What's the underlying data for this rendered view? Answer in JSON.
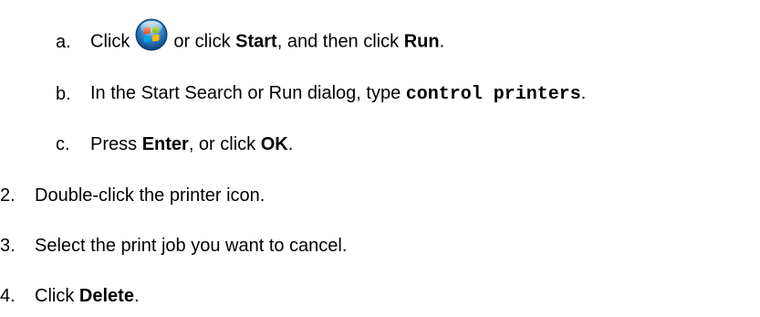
{
  "steps": {
    "a": {
      "marker": "a.",
      "text_before": "Click",
      "text_or": "or click",
      "start": "Start",
      "text_then": ", and then click",
      "run": "Run",
      "end": "."
    },
    "b": {
      "marker": "b.",
      "text_before": "In the Start Search or Run dialog, type",
      "command": "control printers",
      "end": "."
    },
    "c": {
      "marker": "c.",
      "text_before": "Press",
      "enter": "Enter",
      "text_or": ", or click",
      "ok": "OK",
      "end": "."
    },
    "s2": {
      "marker": "2.",
      "text": "Double-click the printer icon."
    },
    "s3": {
      "marker": "3.",
      "text": "Select the print job you want to cancel."
    },
    "s4": {
      "marker": "4.",
      "text_before": "Click",
      "delete": "Delete",
      "end": "."
    }
  },
  "icons": {
    "start_orb": "windows-start-orb-icon"
  },
  "colors": {
    "text": "#000000",
    "background": "#ffffff"
  }
}
